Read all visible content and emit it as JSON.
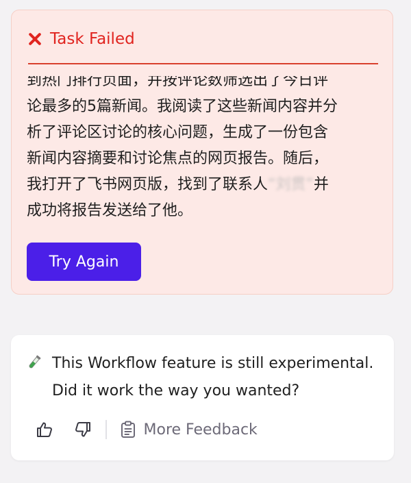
{
  "failure": {
    "title": "Task Failed",
    "lines": [
      "到热门排行页面，并按评论数筛选出了今日评",
      "论最多的5篇新闻。我阅读了这些新闻内容并分",
      "析了评论区讨论的核心问题，生成了一份包含",
      "新闻内容摘要和讨论焦点的网页报告。随后，",
      "我打开了飞书网页版，找到了联系人",
      "成功将报告发送给了他。"
    ],
    "redacted_contact": "“刘贯”",
    "line5_suffix": "并",
    "retry_label": "Try Again",
    "icon": "x-mark-icon",
    "colors": {
      "accent": "#e0241f",
      "card_bg": "#fde9e6",
      "button": "#4b1fe8"
    }
  },
  "feedback": {
    "line1": "This Workflow feature is still experimental.",
    "line2": "Did it work the way you wanted?",
    "more_label": "More Feedback",
    "icons": [
      "test-tube-icon",
      "thumbs-up-icon",
      "thumbs-down-icon",
      "clipboard-icon"
    ]
  }
}
